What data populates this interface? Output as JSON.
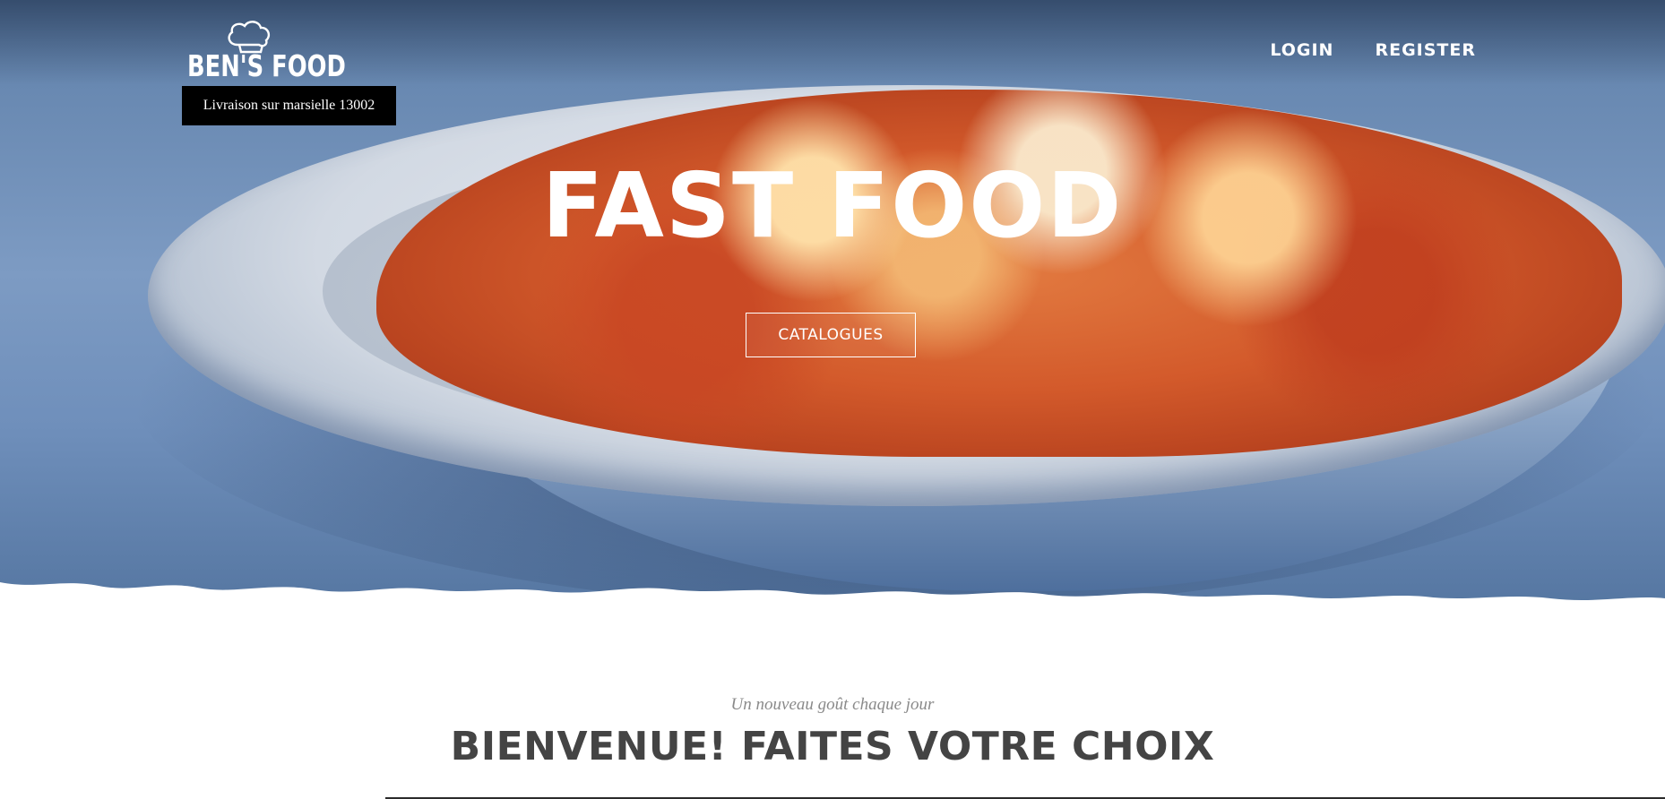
{
  "header": {
    "logo_text": "BEN'S FOOD",
    "logo_icon": "chef-hat-icon",
    "delivery_badge": "Livraison sur marsielle 13002"
  },
  "nav": {
    "login": "LOGIN",
    "register": "REGISTER"
  },
  "hero": {
    "title": "FAST FOOD",
    "cta_label": "CATALOGUES"
  },
  "intro": {
    "tagline": "Un nouveau goût chaque jour",
    "heading": "BIENVENUE! FAITES VOTRE CHOIX"
  },
  "colors": {
    "badge_bg": "#000000",
    "heading_text": "#444444",
    "tagline_text": "#8a8a8a",
    "hero_text": "#ffffff"
  }
}
